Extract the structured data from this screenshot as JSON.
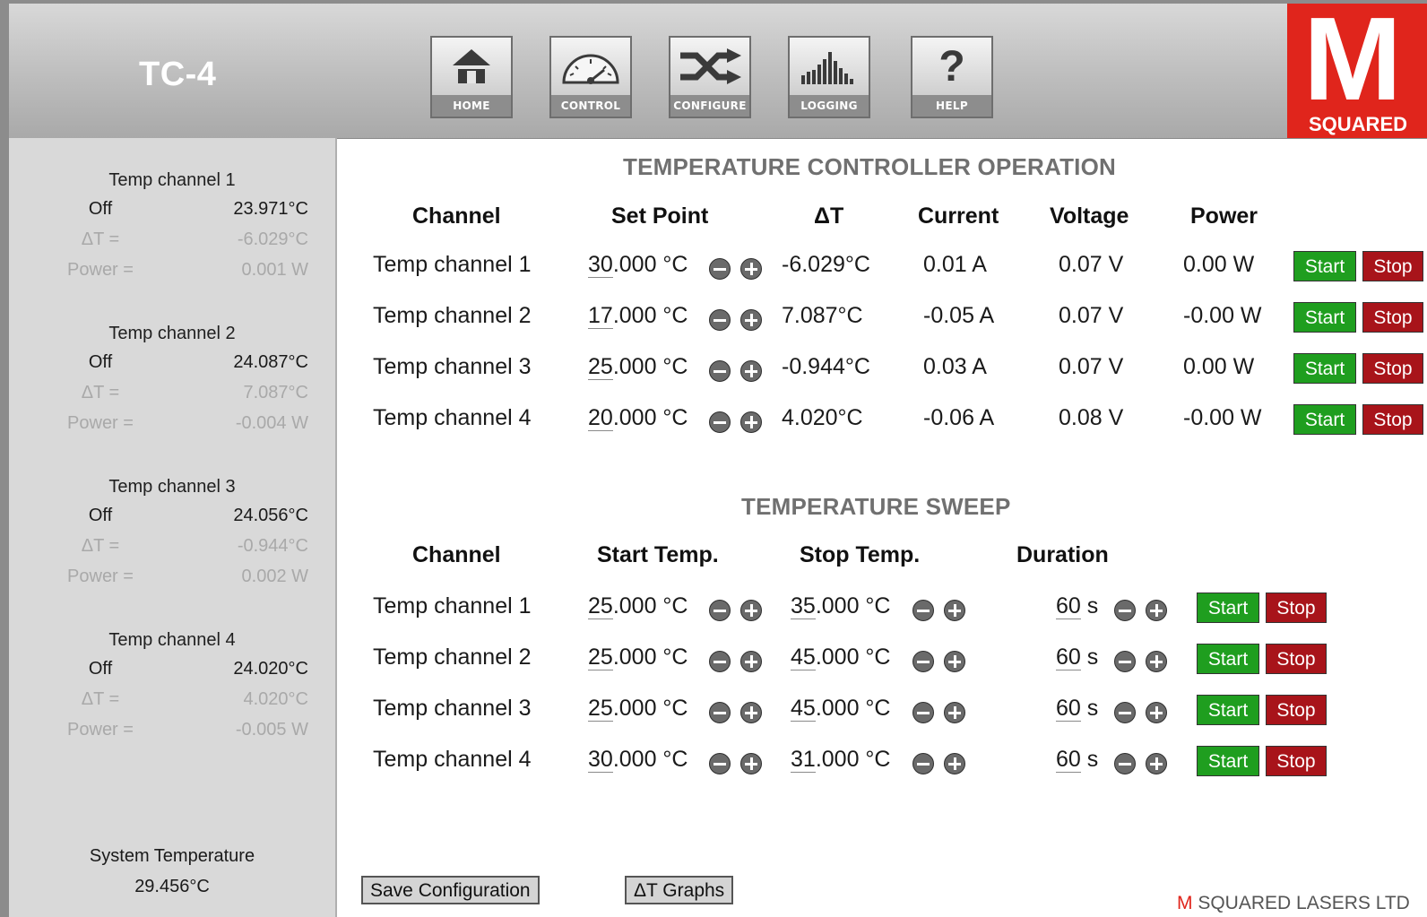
{
  "app": {
    "title": "TC-4"
  },
  "nav": [
    {
      "label": "HOME",
      "icon": "home-icon"
    },
    {
      "label": "CONTROL",
      "icon": "gauge-icon"
    },
    {
      "label": "CONFIGURE",
      "icon": "shuffle-icon"
    },
    {
      "label": "LOGGING",
      "icon": "bar-graph-icon"
    },
    {
      "label": "HELP",
      "icon": "question-icon"
    }
  ],
  "logo": {
    "letter": "M",
    "text": "SQUARED"
  },
  "colors": {
    "accent": "#e0251c",
    "start": "#1f9e1f",
    "stop": "#a8141a",
    "sidebar": "#d9d9d9"
  },
  "sidebar": {
    "delta_label": "ΔT =",
    "power_label": "Power =",
    "channels": [
      {
        "name": "Temp channel 1",
        "state": "Off",
        "temp": "23.971°C",
        "delta": "-6.029°C",
        "power": "0.001 W"
      },
      {
        "name": "Temp channel 2",
        "state": "Off",
        "temp": "24.087°C",
        "delta": "7.087°C",
        "power": "-0.004 W"
      },
      {
        "name": "Temp channel 3",
        "state": "Off",
        "temp": "24.056°C",
        "delta": "-0.944°C",
        "power": "0.002 W"
      },
      {
        "name": "Temp channel 4",
        "state": "Off",
        "temp": "24.020°C",
        "delta": "4.020°C",
        "power": "-0.005 W"
      }
    ],
    "system_label": "System Temperature",
    "system_temp": "29.456°C"
  },
  "operation": {
    "title": "TEMPERATURE CONTROLLER OPERATION",
    "headers": [
      "Channel",
      "Set Point",
      "ΔT",
      "Current",
      "Voltage",
      "Power"
    ],
    "rows": [
      {
        "channel": "Temp channel 1",
        "sp_int": "30",
        "sp_rest": ".000 °C",
        "delta": "-6.029°C",
        "current": "0.01 A",
        "voltage": "0.07 V",
        "power": "0.00 W"
      },
      {
        "channel": "Temp channel 2",
        "sp_int": "17",
        "sp_rest": ".000 °C",
        "delta": "7.087°C",
        "current": "-0.05 A",
        "voltage": "0.07 V",
        "power": "-0.00 W"
      },
      {
        "channel": "Temp channel 3",
        "sp_int": "25",
        "sp_rest": ".000 °C",
        "delta": "-0.944°C",
        "current": "0.03 A",
        "voltage": "0.07 V",
        "power": "0.00 W"
      },
      {
        "channel": "Temp channel 4",
        "sp_int": "20",
        "sp_rest": ".000 °C",
        "delta": "4.020°C",
        "current": "-0.06 A",
        "voltage": "0.08 V",
        "power": "-0.00 W"
      }
    ],
    "start_label": "Start",
    "stop_label": "Stop"
  },
  "sweep": {
    "title": "TEMPERATURE SWEEP",
    "headers": [
      "Channel",
      "Start Temp.",
      "Stop Temp.",
      "Duration"
    ],
    "rows": [
      {
        "channel": "Temp channel 1",
        "start_int": "25",
        "start_rest": ".000 °C",
        "stop_int": "35",
        "stop_rest": ".000 °C",
        "dur_int": "60",
        "dur_rest": " s"
      },
      {
        "channel": "Temp channel 2",
        "start_int": "25",
        "start_rest": ".000 °C",
        "stop_int": "45",
        "stop_rest": ".000 °C",
        "dur_int": "60",
        "dur_rest": " s"
      },
      {
        "channel": "Temp channel 3",
        "start_int": "25",
        "start_rest": ".000 °C",
        "stop_int": "45",
        "stop_rest": ".000 °C",
        "dur_int": "60",
        "dur_rest": " s"
      },
      {
        "channel": "Temp channel 4",
        "start_int": "30",
        "start_rest": ".000 °C",
        "stop_int": "31",
        "stop_rest": ".000 °C",
        "dur_int": "60",
        "dur_rest": " s"
      }
    ],
    "start_label": "Start",
    "stop_label": "Stop"
  },
  "footer": {
    "save_label": "Save Configuration",
    "graphs_label": "ΔT Graphs",
    "brand_m": "M",
    "brand_text": " SQUARED LASERS LTD"
  }
}
